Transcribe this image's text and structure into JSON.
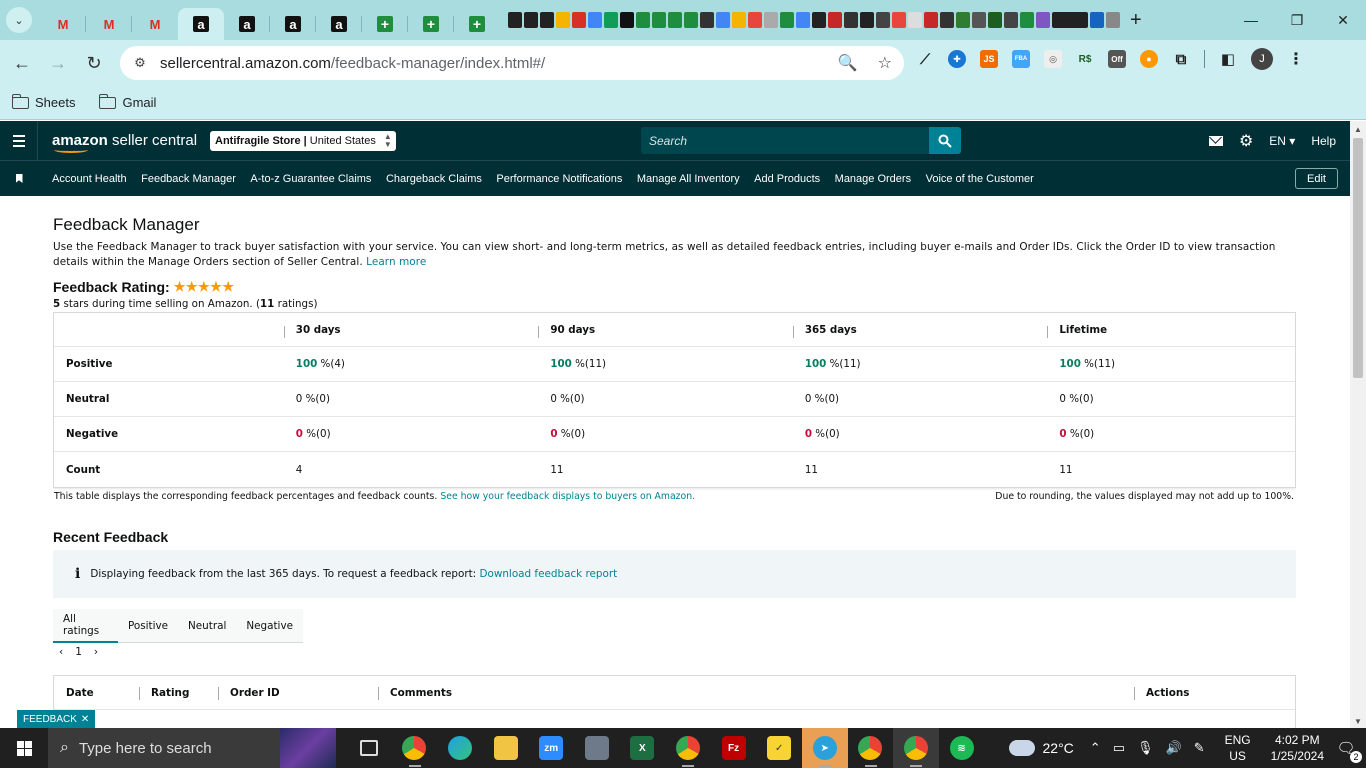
{
  "browser": {
    "tabs_gmail": [
      "M",
      "M",
      "M"
    ],
    "tabs_amazon": [
      "a",
      "a",
      "a",
      "a"
    ],
    "tabs_green": [
      "+",
      "+",
      "+"
    ],
    "url_host": "sellercentral.amazon.com",
    "url_path": "/feedback-manager/index.html#/",
    "profile_initial": "J",
    "bookmarks": [
      "Sheets",
      "Gmail"
    ],
    "ext_labels": [
      "JS",
      "FBA",
      "R$",
      "Off"
    ]
  },
  "header": {
    "logo_bold": "amazon",
    "logo_rest": " seller central",
    "store_name": "Antifragile Store",
    "store_region": "United States",
    "search_placeholder": "Search",
    "language": "EN",
    "help": "Help"
  },
  "nav": {
    "links": [
      "Account Health",
      "Feedback Manager",
      "A-to-z Guarantee Claims",
      "Chargeback Claims",
      "Performance Notifications",
      "Manage All Inventory",
      "Add Products",
      "Manage Orders",
      "Voice of the Customer"
    ],
    "edit": "Edit"
  },
  "page": {
    "title": "Feedback Manager",
    "description": "Use the Feedback Manager to track buyer satisfaction with your service. You can view short- and long-term metrics, as well as detailed feedback entries, including buyer e-mails and Order IDs. Click the Order ID to view transaction details within the Manage Orders section of Seller Central.",
    "learn_more": "Learn more",
    "rating_label": "Feedback Rating:",
    "stars_glyph": "★★★★★",
    "rating_stars_text": "5",
    "rating_mid": "stars during time selling on Amazon. (",
    "rating_count": "11",
    "rating_end": "ratings)"
  },
  "feedback_table": {
    "columns": [
      "30 days",
      "90 days",
      "365 days",
      "Lifetime"
    ],
    "rows": [
      {
        "label": "Positive",
        "cells": [
          [
            "100",
            " %(4)"
          ],
          [
            "100",
            " %(11)"
          ],
          [
            "100",
            " %(11)"
          ],
          [
            "100",
            " %(11)"
          ]
        ]
      },
      {
        "label": "Neutral",
        "cells": [
          [
            "0",
            " %(0)"
          ],
          [
            "0",
            " %(0)"
          ],
          [
            "0",
            " %(0)"
          ],
          [
            "0",
            " %(0)"
          ]
        ]
      },
      {
        "label": "Negative",
        "cells": [
          [
            "0",
            " %(0)"
          ],
          [
            "0",
            " %(0)"
          ],
          [
            "0",
            " %(0)"
          ],
          [
            "0",
            " %(0)"
          ]
        ]
      },
      {
        "label": "Count",
        "cells": [
          [
            "4",
            ""
          ],
          [
            "11",
            ""
          ],
          [
            "11",
            ""
          ],
          [
            "11",
            ""
          ]
        ]
      }
    ],
    "note_left": "This table displays the corresponding feedback percentages and feedback counts.",
    "note_link": "See how your feedback displays to buyers on Amazon.",
    "note_right": "Due to rounding, the values displayed may not add up to 100%."
  },
  "recent": {
    "title": "Recent Feedback",
    "info": "Displaying feedback from the last 365 days. To request a feedback report:",
    "info_link": "Download feedback report",
    "tabs": [
      "All ratings",
      "Positive",
      "Neutral",
      "Negative"
    ],
    "page": "1",
    "columns": [
      "Date",
      "Rating",
      "Order ID",
      "Comments",
      "Actions"
    ],
    "feedback_tab": "FEEDBACK"
  },
  "taskbar": {
    "search_placeholder": "Type here to search",
    "temperature": "22°C",
    "lang_top": "ENG",
    "lang_bottom": "US",
    "time": "4:02 PM",
    "date": "1/25/2024",
    "notif_count": "2"
  }
}
